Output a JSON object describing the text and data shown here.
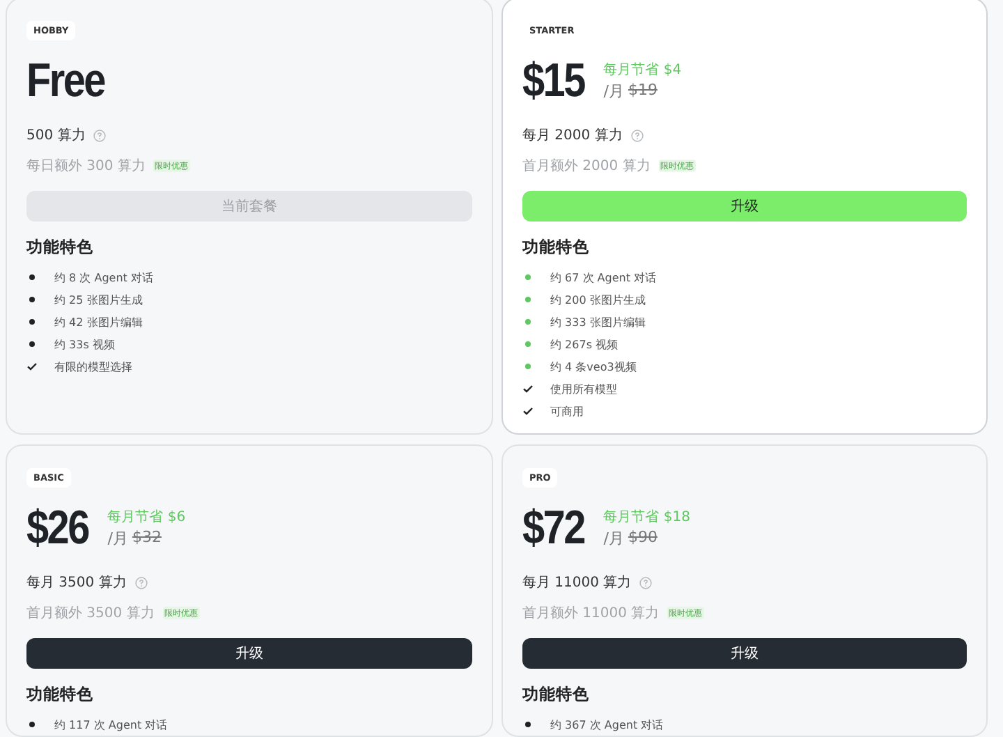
{
  "plans": [
    {
      "tier": "HOBBY",
      "highlighted": false,
      "price": "Free",
      "credits": "500 算力",
      "bonus": "每日额外 300 算力",
      "bonus_tag": "限时优惠",
      "button": {
        "label": "当前套餐",
        "kind": "current"
      },
      "features_title": "功能特色",
      "features": [
        {
          "kind": "dot",
          "text": "约 8 次 Agent 对话"
        },
        {
          "kind": "dot",
          "text": "约 25 张图片生成"
        },
        {
          "kind": "dot",
          "text": "约 42 张图片编辑"
        },
        {
          "kind": "dot",
          "text": "约 33s 视频"
        },
        {
          "kind": "check",
          "text": "有限的模型选择"
        }
      ]
    },
    {
      "tier": "STARTER",
      "highlighted": true,
      "price": "$15",
      "saving": "每月节省 $4",
      "per": "/月",
      "old_price": "$19",
      "credits": "每月 2000 算力",
      "bonus": "首月额外 2000 算力",
      "bonus_tag": "限时优惠",
      "button": {
        "label": "升级",
        "kind": "accent"
      },
      "features_title": "功能特色",
      "features": [
        {
          "kind": "dot",
          "text": "约 67 次 Agent 对话"
        },
        {
          "kind": "dot",
          "text": "约 200 张图片生成"
        },
        {
          "kind": "dot",
          "text": "约 333 张图片编辑"
        },
        {
          "kind": "dot",
          "text": "约 267s 视频"
        },
        {
          "kind": "dot",
          "text": "约 4 条veo3视频"
        },
        {
          "kind": "check",
          "text": "使用所有模型"
        },
        {
          "kind": "check",
          "text": "可商用"
        }
      ]
    },
    {
      "tier": "BASIC",
      "highlighted": false,
      "price": "$26",
      "saving": "每月节省 $6",
      "per": "/月",
      "old_price": "$32",
      "credits": "每月 3500 算力",
      "bonus": "首月额外 3500 算力",
      "bonus_tag": "限时优惠",
      "button": {
        "label": "升级",
        "kind": "dark"
      },
      "features_title": "功能特色",
      "features": [
        {
          "kind": "dot",
          "text": "约 117 次 Agent 对话"
        }
      ]
    },
    {
      "tier": "PRO",
      "highlighted": false,
      "price": "$72",
      "saving": "每月节省 $18",
      "per": "/月",
      "old_price": "$90",
      "credits": "每月 11000 算力",
      "bonus": "首月额外 11000 算力",
      "bonus_tag": "限时优惠",
      "button": {
        "label": "升级",
        "kind": "dark"
      },
      "features_title": "功能特色",
      "features": [
        {
          "kind": "dot",
          "text": "约 367 次 Agent 对话"
        }
      ]
    }
  ]
}
